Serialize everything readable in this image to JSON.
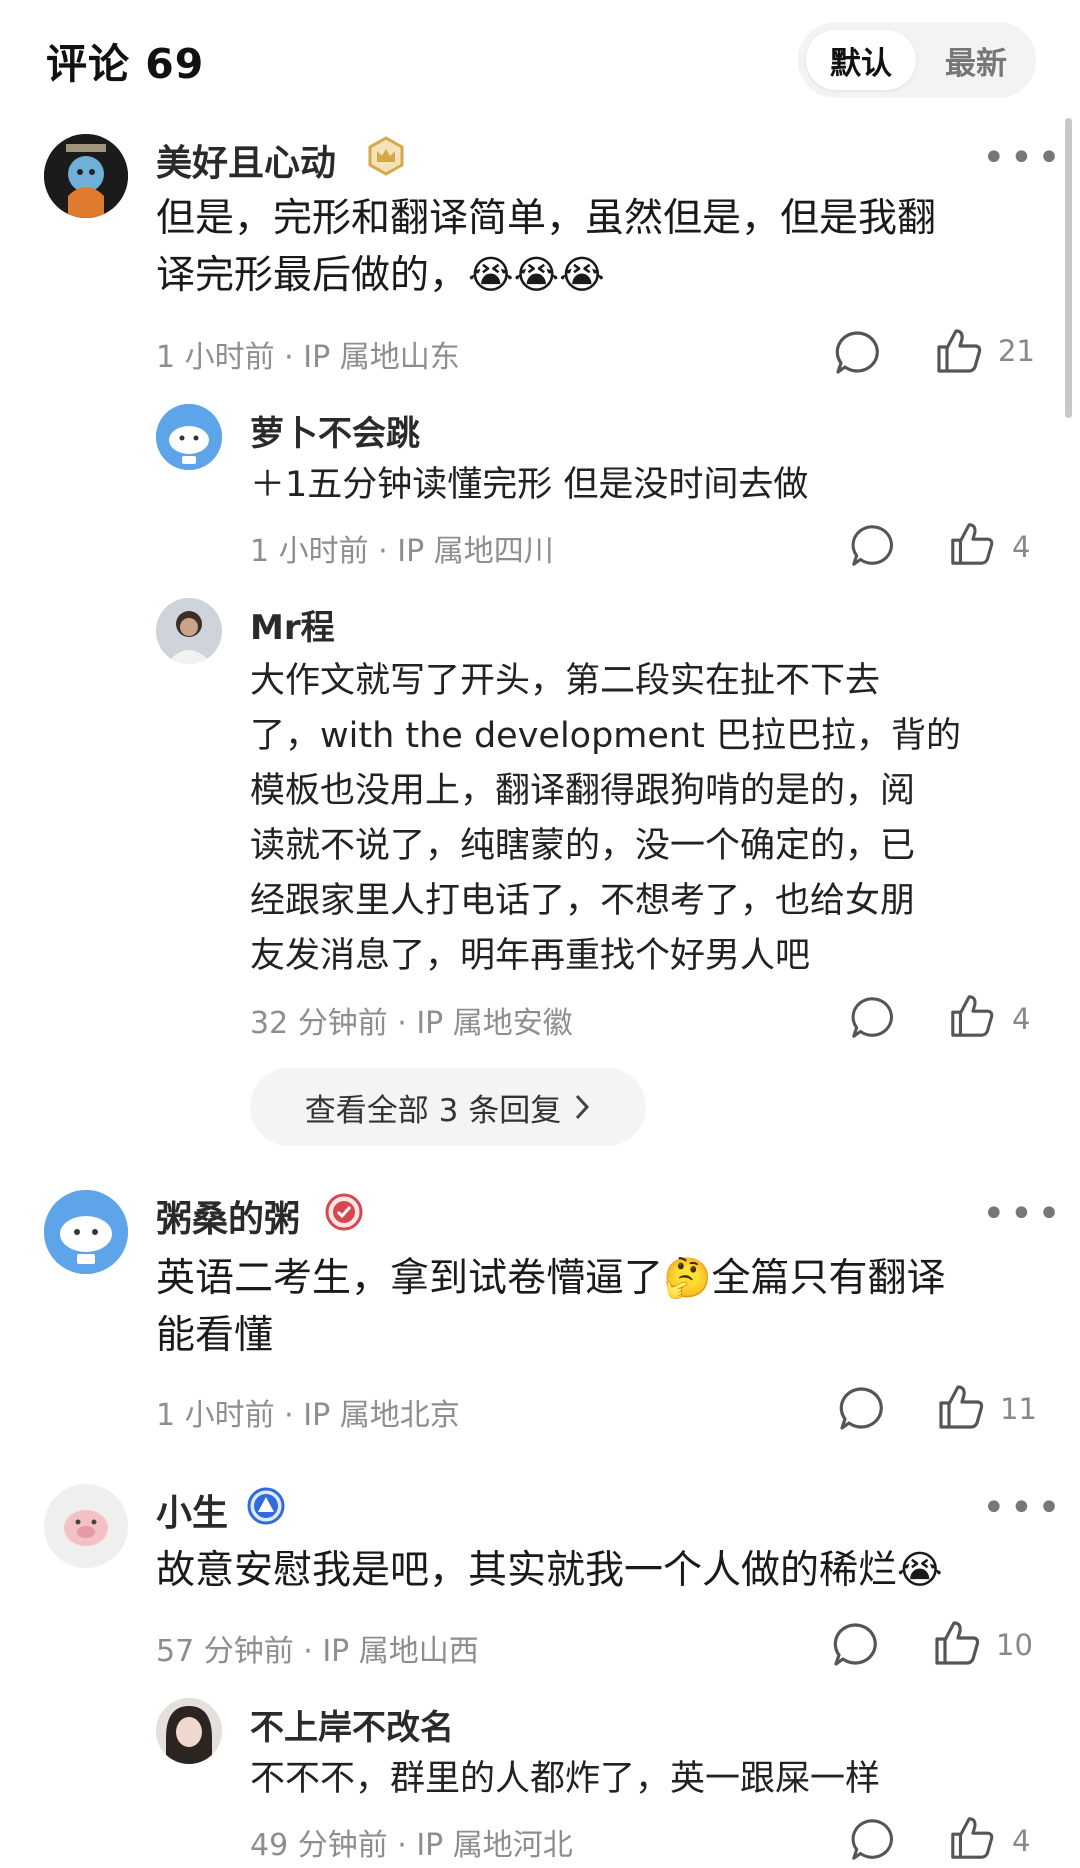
{
  "header": {
    "title": "评论 69",
    "sort_default": "默认",
    "sort_latest": "最新"
  },
  "comments": [
    {
      "user": "美好且心动",
      "badge": "crown-badge-icon",
      "text_line1": "但是，完形和翻译简单，虽然但是，但是我翻",
      "text_line2": "译完形最后做的，😭😭😭",
      "meta": "1 小时前 · IP 属地山东",
      "likes": "21",
      "replies": [
        {
          "user": "萝卜不会跳",
          "text_lines": [
            "＋1五分钟读懂完形 但是没时间去做"
          ],
          "meta": "1 小时前 · IP 属地四川",
          "likes": "4"
        },
        {
          "user": "Mr程",
          "text_lines": [
            "大作文就写了开头，第二段实在扯不下去",
            "了，with the development 巴拉巴拉，背的",
            "模板也没用上，翻译翻得跟狗啃的是的，阅",
            "读就不说了，纯瞎蒙的，没一个确定的，已",
            "经跟家里人打电话了，不想考了，也给女朋",
            "友发消息了，明年再重找个好男人吧"
          ],
          "meta": "32 分钟前 · IP 属地安徽",
          "likes": "4"
        }
      ],
      "view_all": "查看全部 3 条回复"
    },
    {
      "user": "粥桑的粥",
      "badge": "check-badge-icon",
      "text_line1": "英语二考生，拿到试卷懵逼了🤔全篇只有翻译",
      "text_line2": "能看懂",
      "meta": "1 小时前 · IP 属地北京",
      "likes": "11"
    },
    {
      "user": "小生",
      "badge": "level-badge-icon",
      "text_line1": "故意安慰我是吧，其实就我一个人做的稀烂😭",
      "meta": "57 分钟前 · IP 属地山西",
      "likes": "10",
      "replies": [
        {
          "user": "不上岸不改名",
          "text_lines": [
            "不不不，群里的人都炸了，英一跟屎一样"
          ],
          "meta": "49 分钟前 · IP 属地河北",
          "likes": "4"
        }
      ]
    }
  ],
  "colors": {
    "badge_gold": "#d4a94a",
    "badge_red": "#d8474f",
    "badge_blue": "#2f6bdc",
    "meta_gray": "#8e8e8e"
  }
}
